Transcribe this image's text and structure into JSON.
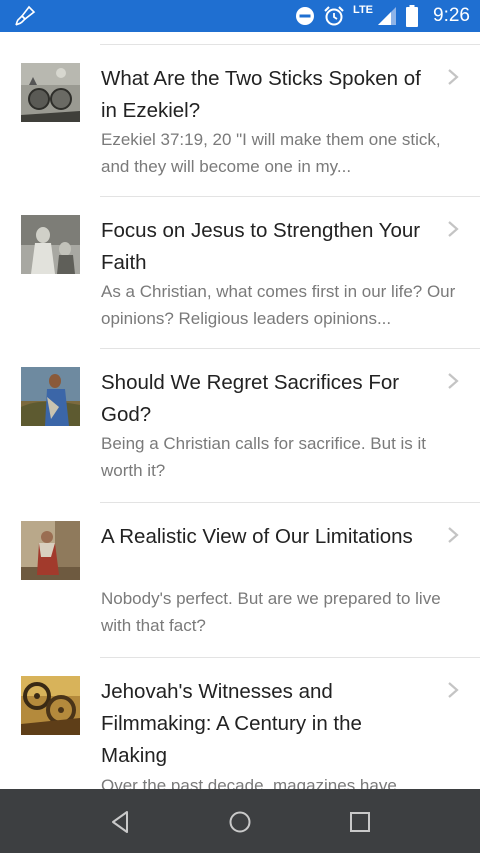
{
  "status_bar": {
    "network_label": "LTE",
    "time": "9:26",
    "colors": {
      "background": "#1f6fd1"
    }
  },
  "articles": [
    {
      "title": "What Are the Two Sticks Spoken of in Ezekiel?",
      "description": "Ezekiel 37:19, 20 \"I will make them one stick, and they will become one in my...",
      "thumbnail": "engraving-vision-image"
    },
    {
      "title": "Focus on Jesus to Strengthen Your Faith",
      "description": "As a Christian, what comes first in our life? Our opinions? Religious leaders opinions...",
      "thumbnail": "engraving-figures-image"
    },
    {
      "title": "Should We Regret Sacrifices For God?",
      "description": "Being a Christian calls for sacrifice. But is it worth it?",
      "thumbnail": "painting-robed-man-image"
    },
    {
      "title": "A Realistic View of Our Limitations",
      "description": "Nobody's perfect. But are we prepared to live with that fact?",
      "thumbnail": "painting-mourning-figure-image"
    },
    {
      "title": "Jehovah's Witnesses and Filmmaking: A Century in the Making",
      "description": "Over the past decade, magazines have",
      "thumbnail": "film-reels-image"
    }
  ],
  "nav_bar": {
    "back": "back-icon",
    "home": "home-icon",
    "recents": "recents-icon"
  }
}
